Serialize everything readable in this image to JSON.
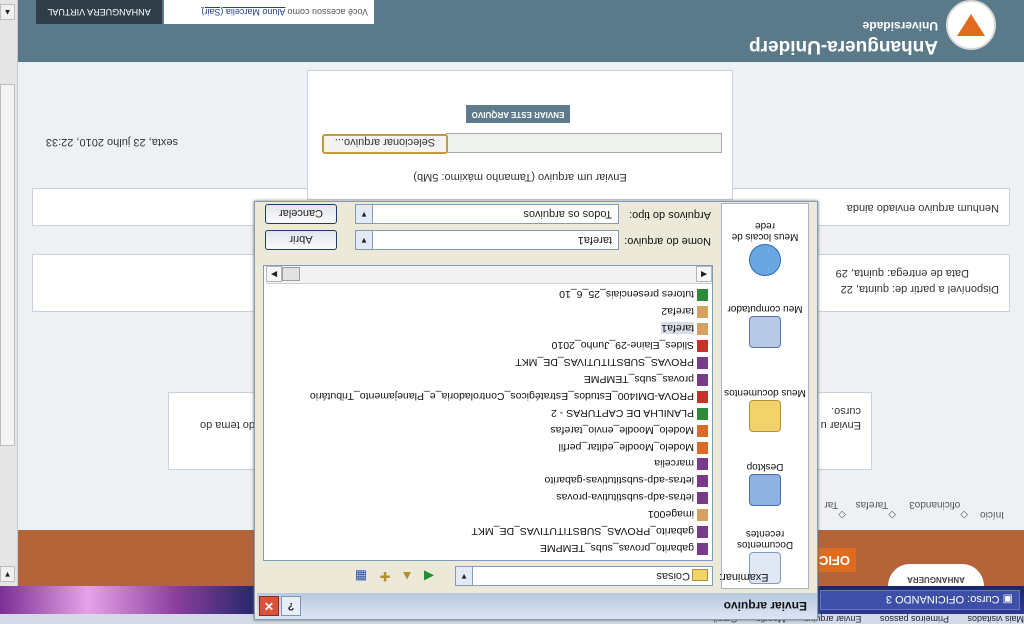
{
  "browser": {
    "bookmarks": [
      "Mais visitados",
      "Primeiros passos",
      "Enviar arquivo",
      "Moodle",
      "Gmail"
    ],
    "taskbar_window": "Curso: OFICINANDO 3"
  },
  "page": {
    "university_name": "Anhanguera-Uniderp",
    "university_label": "Universidade",
    "logo_text": "ANHANGUERA",
    "user_prefix": "Você acessou como",
    "user_name": "Aluno Marcelia (Sair)",
    "virtual_button": "ANHANGUERA VIRTUAL",
    "upload_button": "ENVIAR ESTE ARQUIVO",
    "select_file_button": "Selecionar arquivo...",
    "file_input_value": "",
    "max_size_text": "Enviar um arquivo (Tamanho máximo: 5Mb)",
    "no_files_text": "Nenhum arquivo enviado ainda",
    "available_from": "Disponível a partir de: quinta, 22",
    "due_date": "Data de entrega: quinta, 29",
    "description_line1": "Enviar u",
    "description_line2": "curso.",
    "description_right": "do tema do",
    "date_time": "sexta, 23 julho 2010, 22:33",
    "footer_tab": "OFIC",
    "breadcrumbs": [
      "Início",
      "oficinando3",
      "Tarefas",
      "Tar"
    ]
  },
  "dialog": {
    "title": "Enviar arquivo",
    "look_in_label": "Examinar:",
    "look_in_value": "Coisas",
    "file_name_label": "Nome do arquivo:",
    "file_name_value": "tarefa1",
    "file_type_label": "Arquivos do tipo:",
    "file_type_value": "Todos os arquivos",
    "open_button": "Abrir",
    "cancel_button": "Cancelar",
    "places": [
      "Documentos recentes",
      "Desktop",
      "Meus documentos",
      "Meu computador",
      "Meus locais de rede"
    ],
    "files": [
      {
        "name": "gabarito_provas_subs_TEMPME",
        "kind": "rar"
      },
      {
        "name": "gabarito_PROVAS_SUBSTITUTIVAS_DE_MKT",
        "kind": "rar"
      },
      {
        "name": "image001",
        "kind": "img"
      },
      {
        "name": "letras-adp-substitutiva-provas",
        "kind": "rar"
      },
      {
        "name": "letras-adp-substitutivas-gabarito",
        "kind": "rar"
      },
      {
        "name": "marcelia",
        "kind": "rar"
      },
      {
        "name": "Modelo_Moodle_editar_perfil",
        "kind": "ppt"
      },
      {
        "name": "Modelo_Moodle_envio_tarefas",
        "kind": "ppt"
      },
      {
        "name": "PLANILHA DE CAPTURAS - 2",
        "kind": "xls"
      },
      {
        "name": "PROVA-DMI400_Estudos_Estratégicos_Controladoria_e_Planejamento_Tributário",
        "kind": "pdf"
      },
      {
        "name": "provas_subs_TEMPME",
        "kind": "rar"
      },
      {
        "name": "PROVAS_SUBSTITUTIVAS_DE_MKT",
        "kind": "rar"
      },
      {
        "name": "Slides_Elaine-29_Junho_2010",
        "kind": "pdf"
      },
      {
        "name": "tarefa1",
        "kind": "img",
        "selected": true
      },
      {
        "name": "tarefa2",
        "kind": "img"
      },
      {
        "name": "tutores presenciais_25_6_10",
        "kind": "xls"
      }
    ]
  }
}
